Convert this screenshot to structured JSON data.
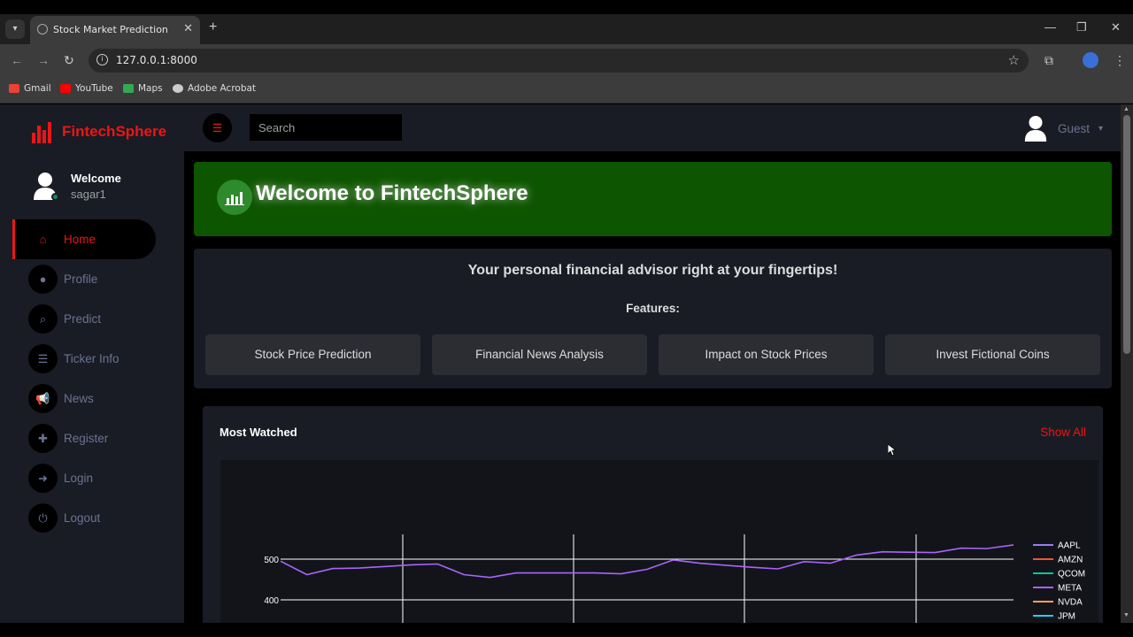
{
  "browser": {
    "tab_title": "Stock Market Prediction",
    "url": "127.0.0.1:8000",
    "bookmarks": [
      {
        "label": "Gmail",
        "color": "#ea4335"
      },
      {
        "label": "YouTube",
        "color": "#ff0000"
      },
      {
        "label": "Maps",
        "color": "#34a853"
      },
      {
        "label": "Adobe Acrobat",
        "color": "#cccccc"
      }
    ]
  },
  "app": {
    "brand": "FintechSphere",
    "brand_color": "#eb1616",
    "user": {
      "greeting": "Welcome",
      "name": "sagar1"
    },
    "menu": [
      {
        "label": "Home",
        "icon": "home-icon",
        "glyph": "⌂",
        "active": true
      },
      {
        "label": "Profile",
        "icon": "user-icon",
        "glyph": "●",
        "active": false
      },
      {
        "label": "Predict",
        "icon": "search-icon",
        "glyph": "⌕",
        "active": false
      },
      {
        "label": "Ticker Info",
        "icon": "list-icon",
        "glyph": "☰",
        "active": false
      },
      {
        "label": "News",
        "icon": "bullhorn-icon",
        "glyph": "📢",
        "active": false
      },
      {
        "label": "Register",
        "icon": "user-plus-icon",
        "glyph": "✚",
        "active": false
      },
      {
        "label": "Login",
        "icon": "sign-in-icon",
        "glyph": "➜",
        "active": false
      },
      {
        "label": "Logout",
        "icon": "sign-out-icon",
        "glyph": "⏻",
        "active": false
      }
    ],
    "search_placeholder": "Search",
    "guest_label": "Guest"
  },
  "welcome": {
    "title": "Welcome to FintechSphere"
  },
  "features": {
    "tagline": "Your personal financial advisor right at your fingertips!",
    "label": "Features:",
    "items": [
      "Stock Price Prediction",
      "Financial News Analysis",
      "Impact on Stock Prices",
      "Invest Fictional Coins"
    ]
  },
  "most_watched": {
    "title": "Most Watched",
    "show_all": "Show All"
  },
  "chart_data": {
    "type": "line",
    "y_ticks": [
      500,
      400
    ],
    "ylim": [
      380,
      540
    ],
    "legend": [
      {
        "name": "AAPL",
        "color": "#9a7cf0"
      },
      {
        "name": "AMZN",
        "color": "#ef553b"
      },
      {
        "name": "QCOM",
        "color": "#00cc96"
      },
      {
        "name": "META",
        "color": "#ab63fa"
      },
      {
        "name": "NVDA",
        "color": "#ffa15a"
      },
      {
        "name": "JPM",
        "color": "#19d3f3"
      }
    ],
    "series": [
      {
        "name": "META",
        "values": [
          495,
          462,
          477,
          478,
          482,
          486,
          488,
          462,
          455,
          466,
          466,
          466,
          466,
          464,
          475,
          498,
          490,
          485,
          480,
          476,
          494,
          490,
          510,
          518,
          517,
          516,
          527,
          526,
          535
        ]
      }
    ]
  }
}
